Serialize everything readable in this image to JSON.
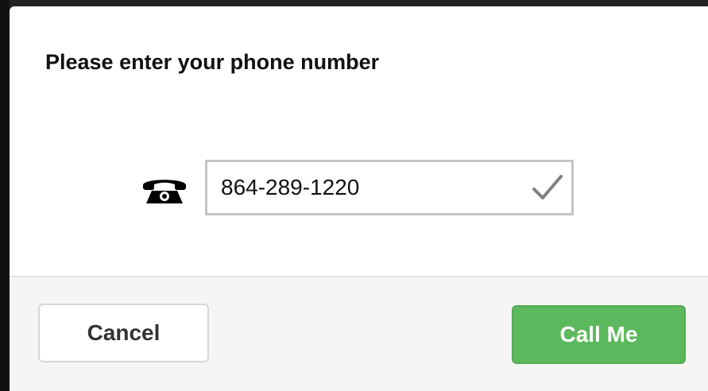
{
  "dialog": {
    "title": "Please enter your phone number",
    "phone": {
      "icon": "telephone-icon",
      "value": "864-289-1220",
      "valid_icon": "checkmark-icon"
    },
    "footer": {
      "cancel_label": "Cancel",
      "call_label": "Call Me"
    }
  },
  "colors": {
    "primary_button": "#5cb85c",
    "input_border": "#c4c4c4",
    "footer_background": "#f5f5f5",
    "checkmark": "#808080"
  }
}
